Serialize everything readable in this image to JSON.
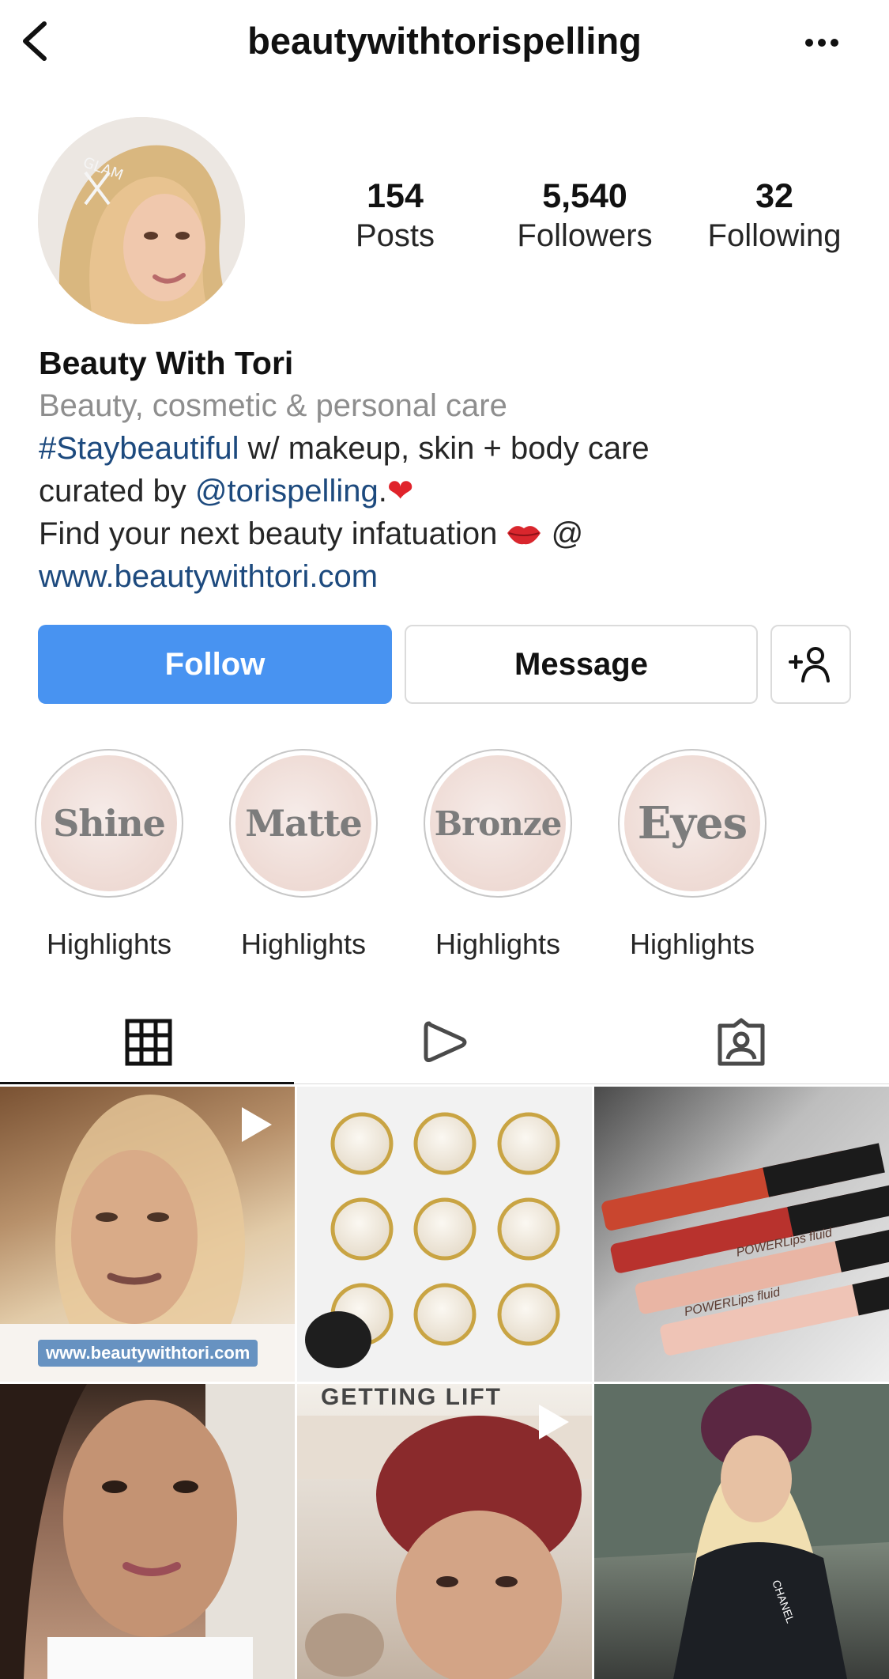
{
  "header": {
    "username": "beautywithtorispelling"
  },
  "stats": [
    {
      "value": "154",
      "label": "Posts"
    },
    {
      "value": "5,540",
      "label": "Followers"
    },
    {
      "value": "32",
      "label": "Following"
    }
  ],
  "bio": {
    "display_name": "Beauty With Tori",
    "category": "Beauty, cosmetic & personal care",
    "hashtag": "#Staybeautiful",
    "line1_rest": " w/ makeup, skin + body care",
    "line2_prefix": "curated by ",
    "mention": "@torispelling",
    "line2_suffix": ".",
    "line3_text": "Find your next beauty infatuation ",
    "line3_at": " @",
    "website": "www.beautywithtori.com"
  },
  "actions": {
    "follow": "Follow",
    "message": "Message"
  },
  "highlights": [
    {
      "title": "Shine",
      "caption": "Highlights"
    },
    {
      "title": "Matte",
      "caption": "Highlights"
    },
    {
      "title": "Bronze",
      "caption": "Highlights"
    },
    {
      "title": "Eyes",
      "caption": "Highlights"
    }
  ],
  "tabs": [
    {
      "icon": "grid-icon"
    },
    {
      "icon": "reels-icon"
    },
    {
      "icon": "tagged-icon"
    }
  ],
  "posts": {
    "post0_overlay": "www.beautywithtori.com",
    "post2_label_a": "POWERLips fluid",
    "post2_label_b": "POWERLips fluid",
    "post4_caption": "GETTING LIFT",
    "post5_text": "CHANEL"
  },
  "colors": {
    "accent": "#4893f1",
    "link": "#1d4a7e",
    "muted": "#8e8e8e"
  }
}
